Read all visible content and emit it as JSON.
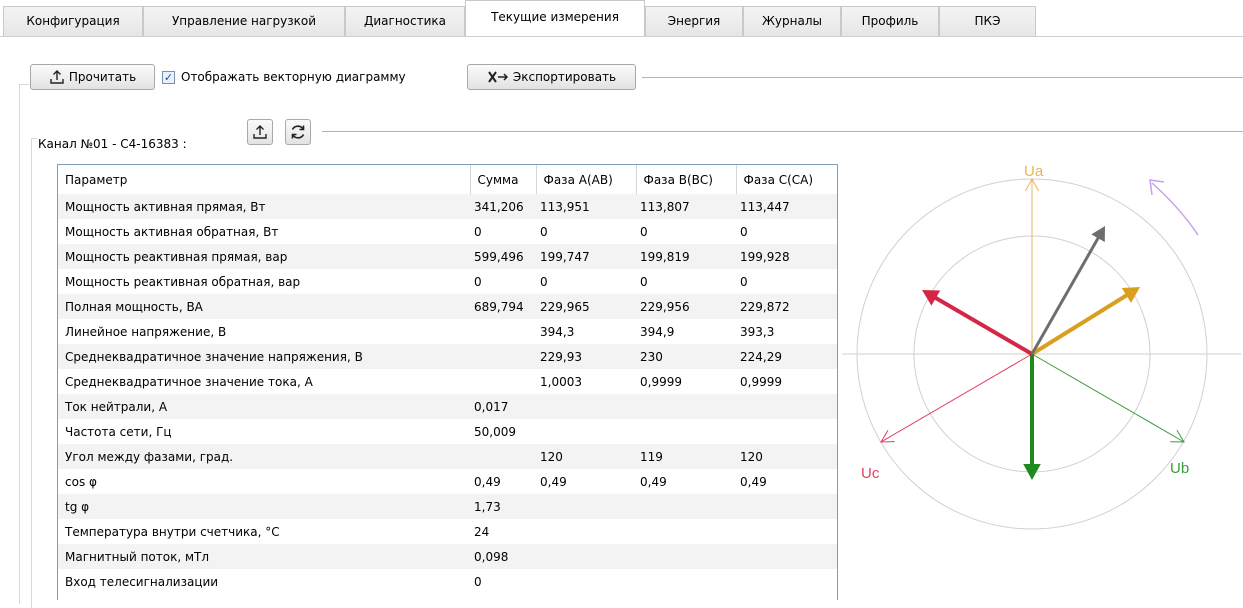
{
  "tabs": [
    {
      "label": "Конфигурация",
      "active": false
    },
    {
      "label": "Управление нагрузкой",
      "active": false
    },
    {
      "label": "Диагностика",
      "active": false
    },
    {
      "label": "Текущие измерения",
      "active": true
    },
    {
      "label": "Энергия",
      "active": false
    },
    {
      "label": "Журналы",
      "active": false
    },
    {
      "label": "Профиль",
      "active": false
    },
    {
      "label": "ПКЭ",
      "active": false
    }
  ],
  "toolbar": {
    "read_label": "Прочитать",
    "show_vector_label": "Отображать векторную диаграмму",
    "show_vector_checked": true,
    "export_label": "Экспортировать"
  },
  "channel": {
    "label": "Канал №01 - С4-16383 :",
    "upload_icon": "upload-icon",
    "refresh_icon": "refresh-icon"
  },
  "table": {
    "headers": [
      "Параметр",
      "Сумма",
      "Фаза А(АВ)",
      "Фаза В(ВС)",
      "Фаза С(СА)"
    ],
    "rows": [
      [
        "Мощность активная прямая, Вт",
        "341,206",
        "113,951",
        "113,807",
        "113,447"
      ],
      [
        "Мощность активная обратная, Вт",
        "0",
        "0",
        "0",
        "0"
      ],
      [
        "Мощность реактивная прямая, вар",
        "599,496",
        "199,747",
        "199,819",
        "199,928"
      ],
      [
        "Мощность реактивная обратная, вар",
        "0",
        "0",
        "0",
        "0"
      ],
      [
        "Полная мощность, ВА",
        "689,794",
        "229,965",
        "229,956",
        "229,872"
      ],
      [
        "Линейное напряжение, В",
        "",
        "394,3",
        "394,9",
        "393,3"
      ],
      [
        "Среднеквадратичное значение напряжения, В",
        "",
        "229,93",
        "230",
        "224,29"
      ],
      [
        "Среднеквадратичное значение тока, А",
        "",
        "1,0003",
        "0,9999",
        "0,9999"
      ],
      [
        "Ток нейтрали, А",
        "0,017",
        "",
        "",
        ""
      ],
      [
        "Частота сети, Гц",
        "50,009",
        "",
        "",
        ""
      ],
      [
        "Угол между фазами, град.",
        "",
        "120",
        "119",
        "120"
      ],
      [
        "cos φ",
        "0,49",
        "0,49",
        "0,49",
        "0,49"
      ],
      [
        "tg φ",
        "1,73",
        "",
        "",
        ""
      ],
      [
        "Температура внутри счетчика, °С",
        "24",
        "",
        "",
        ""
      ],
      [
        "Магнитный поток, мТл",
        "0,098",
        "",
        "",
        ""
      ],
      [
        "Вход телесигнализации",
        "0",
        "",
        "",
        ""
      ]
    ]
  },
  "diagram": {
    "labels": {
      "ua": "Ua",
      "ub": "Ub",
      "uc": "Uc"
    },
    "colors": {
      "ua": "#e8b55a",
      "ub": "#3b9b3b",
      "uc": "#e0405c",
      "ia": "#d9a020",
      "ib": "#1f8a1f",
      "ic": "#d42747",
      "neutral": "#6e6e6e",
      "rotation": "#c9a0ea",
      "circle": "#d0d0d0",
      "axis": "#cfcfcf"
    }
  }
}
